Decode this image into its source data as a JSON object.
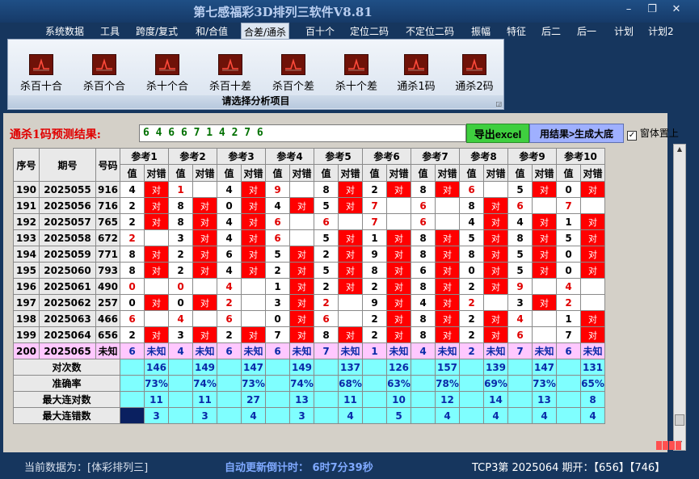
{
  "window": {
    "title": "第七感福彩3D排列三软件V8.81",
    "min": "–",
    "restore": "❐",
    "close": "✕"
  },
  "menu": [
    "系统数据",
    "工具",
    "跨度/复式",
    "和/合值",
    "合差/通杀",
    "百十个",
    "定位二码",
    "不定位二码",
    "振幅",
    "特征",
    "后二",
    "后一",
    "计划",
    "计划2"
  ],
  "menu_active_index": 4,
  "ribbon": {
    "buttons": [
      "杀百十合",
      "杀百个合",
      "杀十个合",
      "杀百十差",
      "杀百个差",
      "杀十个差",
      "通杀1码",
      "通杀2码"
    ],
    "icon": "chart-line-icon",
    "caption": "请选择分析项目",
    "corner": "◲"
  },
  "predict": {
    "label": "通杀1码预测结果:",
    "value": "6 4 6 6 7 1 4 2 7 6",
    "excel_button": "导出excel",
    "gen_button": "用结果>生成大底",
    "topmost_label": "窗体置上",
    "topmost_checked": "✓"
  },
  "table": {
    "headers": {
      "seq": "序号",
      "issue": "期号",
      "number": "号码",
      "value": "值",
      "result": "对错"
    },
    "refs": [
      "参考1",
      "参考2",
      "参考3",
      "参考4",
      "参考5",
      "参考6",
      "参考7",
      "参考8",
      "参考9",
      "参考10"
    ],
    "ok_text": "对",
    "rows": [
      {
        "seq": "190",
        "issue": "2025055",
        "num": "916",
        "cells": [
          [
            "4",
            1,
            0
          ],
          [
            "1",
            0,
            1
          ],
          [
            "4",
            1,
            0
          ],
          [
            "9",
            0,
            1
          ],
          [
            "8",
            1,
            0
          ],
          [
            "2",
            1,
            0
          ],
          [
            "8",
            1,
            0
          ],
          [
            "6",
            0,
            1
          ],
          [
            "5",
            1,
            0
          ],
          [
            "0",
            1,
            0
          ]
        ]
      },
      {
        "seq": "191",
        "issue": "2025056",
        "num": "716",
        "cells": [
          [
            "2",
            1,
            0
          ],
          [
            "8",
            1,
            0
          ],
          [
            "0",
            1,
            0
          ],
          [
            "4",
            1,
            0
          ],
          [
            "5",
            1,
            0
          ],
          [
            "7",
            0,
            1
          ],
          [
            "6",
            0,
            1
          ],
          [
            "8",
            1,
            0
          ],
          [
            "6",
            0,
            1
          ],
          [
            "7",
            0,
            1
          ]
        ]
      },
      {
        "seq": "192",
        "issue": "2025057",
        "num": "765",
        "cells": [
          [
            "2",
            1,
            0
          ],
          [
            "8",
            1,
            0
          ],
          [
            "4",
            1,
            0
          ],
          [
            "6",
            0,
            1
          ],
          [
            "6",
            0,
            1
          ],
          [
            "7",
            0,
            1
          ],
          [
            "6",
            0,
            1
          ],
          [
            "4",
            1,
            0
          ],
          [
            "4",
            1,
            0
          ],
          [
            "1",
            1,
            0
          ]
        ]
      },
      {
        "seq": "193",
        "issue": "2025058",
        "num": "672",
        "cells": [
          [
            "2",
            0,
            1
          ],
          [
            "3",
            1,
            0
          ],
          [
            "4",
            1,
            0
          ],
          [
            "6",
            0,
            1
          ],
          [
            "5",
            1,
            0
          ],
          [
            "1",
            1,
            0
          ],
          [
            "8",
            1,
            0
          ],
          [
            "5",
            1,
            0
          ],
          [
            "8",
            1,
            0
          ],
          [
            "5",
            1,
            0
          ]
        ]
      },
      {
        "seq": "194",
        "issue": "2025059",
        "num": "771",
        "cells": [
          [
            "8",
            1,
            0
          ],
          [
            "2",
            1,
            0
          ],
          [
            "6",
            1,
            0
          ],
          [
            "5",
            1,
            0
          ],
          [
            "2",
            1,
            0
          ],
          [
            "9",
            1,
            0
          ],
          [
            "8",
            1,
            0
          ],
          [
            "8",
            1,
            0
          ],
          [
            "5",
            1,
            0
          ],
          [
            "0",
            1,
            0
          ]
        ]
      },
      {
        "seq": "195",
        "issue": "2025060",
        "num": "793",
        "cells": [
          [
            "8",
            1,
            0
          ],
          [
            "2",
            1,
            0
          ],
          [
            "4",
            1,
            0
          ],
          [
            "2",
            1,
            0
          ],
          [
            "5",
            1,
            0
          ],
          [
            "8",
            1,
            0
          ],
          [
            "6",
            1,
            0
          ],
          [
            "0",
            1,
            0
          ],
          [
            "5",
            1,
            0
          ],
          [
            "0",
            1,
            0
          ]
        ]
      },
      {
        "seq": "196",
        "issue": "2025061",
        "num": "490",
        "cells": [
          [
            "0",
            0,
            1
          ],
          [
            "0",
            0,
            1
          ],
          [
            "4",
            0,
            1
          ],
          [
            "1",
            1,
            0
          ],
          [
            "2",
            1,
            0
          ],
          [
            "2",
            1,
            0
          ],
          [
            "8",
            1,
            0
          ],
          [
            "2",
            1,
            0
          ],
          [
            "9",
            0,
            1
          ],
          [
            "4",
            0,
            1
          ]
        ]
      },
      {
        "seq": "197",
        "issue": "2025062",
        "num": "257",
        "cells": [
          [
            "0",
            1,
            0
          ],
          [
            "0",
            1,
            0
          ],
          [
            "2",
            0,
            1
          ],
          [
            "3",
            1,
            0
          ],
          [
            "2",
            0,
            1
          ],
          [
            "9",
            1,
            0
          ],
          [
            "4",
            1,
            0
          ],
          [
            "2",
            0,
            1
          ],
          [
            "3",
            1,
            0
          ],
          [
            "2",
            0,
            1
          ]
        ]
      },
      {
        "seq": "198",
        "issue": "2025063",
        "num": "466",
        "cells": [
          [
            "6",
            0,
            1
          ],
          [
            "4",
            0,
            1
          ],
          [
            "6",
            0,
            1
          ],
          [
            "0",
            1,
            0
          ],
          [
            "6",
            0,
            1
          ],
          [
            "2",
            1,
            0
          ],
          [
            "8",
            1,
            0
          ],
          [
            "2",
            1,
            0
          ],
          [
            "4",
            0,
            1
          ],
          [
            "1",
            1,
            0
          ]
        ]
      },
      {
        "seq": "199",
        "issue": "2025064",
        "num": "656",
        "cells": [
          [
            "2",
            1,
            0
          ],
          [
            "3",
            1,
            0
          ],
          [
            "2",
            1,
            0
          ],
          [
            "7",
            1,
            0
          ],
          [
            "8",
            1,
            0
          ],
          [
            "2",
            1,
            0
          ],
          [
            "8",
            1,
            0
          ],
          [
            "2",
            1,
            0
          ],
          [
            "6",
            0,
            1
          ],
          [
            "7",
            1,
            0
          ]
        ]
      }
    ],
    "unknown_row": {
      "seq": "200",
      "issue": "2025065",
      "num": "未知",
      "values": [
        "6",
        "4",
        "6",
        "6",
        "7",
        "1",
        "4",
        "2",
        "7",
        "6"
      ],
      "text": "未知"
    },
    "stats": [
      {
        "label": "对次数",
        "values": [
          "146",
          "149",
          "147",
          "149",
          "137",
          "126",
          "157",
          "139",
          "147",
          "131"
        ]
      },
      {
        "label": "准确率",
        "values": [
          "73%",
          "74%",
          "73%",
          "74%",
          "68%",
          "63%",
          "78%",
          "69%",
          "73%",
          "65%"
        ]
      },
      {
        "label": "最大连对数",
        "values": [
          "11",
          "11",
          "27",
          "13",
          "11",
          "10",
          "12",
          "14",
          "13",
          "8"
        ]
      },
      {
        "label": "最大连错数",
        "values": [
          "3",
          "3",
          "4",
          "3",
          "4",
          "5",
          "4",
          "4",
          "4",
          "4"
        ]
      }
    ]
  },
  "scroll": {
    "up": "▲",
    "down": "▼"
  },
  "status": {
    "current": "当前数据为：[体彩排列三]",
    "countdown": "自动更新倒计时：   6时7分39秒",
    "tcp": "TCP3第 2025064 期开：【656】【746】"
  }
}
